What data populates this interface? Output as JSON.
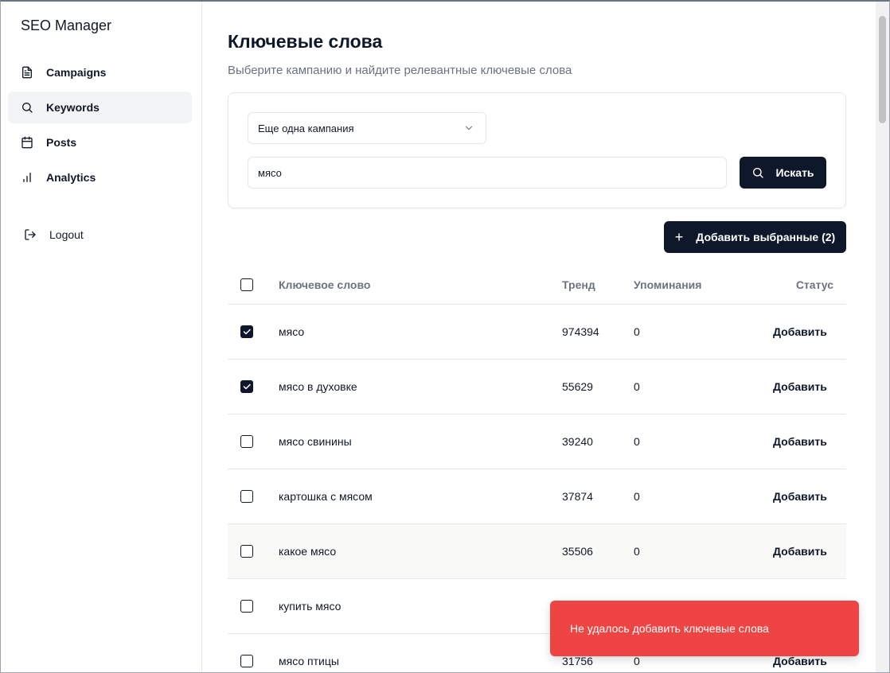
{
  "app": {
    "brand": "SEO Manager"
  },
  "sidebar": {
    "items": [
      {
        "label": "Campaigns",
        "icon": "file-text-icon"
      },
      {
        "label": "Keywords",
        "icon": "search-icon",
        "active": true
      },
      {
        "label": "Posts",
        "icon": "calendar-icon"
      },
      {
        "label": "Analytics",
        "icon": "bar-chart-icon"
      }
    ],
    "logout": {
      "label": "Logout",
      "icon": "log-out-icon"
    }
  },
  "main": {
    "title": "Ключевые слова",
    "subtitle": "Выберите кампанию и найдите релевантные ключевые слова",
    "campaign_select": {
      "value": "Еще одна кампания"
    },
    "query": {
      "value": "мясо"
    },
    "search_label": "Искать",
    "add_selected_label": "Добавить выбранные (2)"
  },
  "table": {
    "headers": {
      "keyword": "Ключевое слово",
      "trend": "Тренд",
      "mentions": "Упоминания",
      "status": "Статус"
    },
    "rows": [
      {
        "keyword": "мясо",
        "trend": "974394",
        "mentions": "0",
        "action": "Добавить",
        "checked": true
      },
      {
        "keyword": "мясо в духовке",
        "trend": "55629",
        "mentions": "0",
        "action": "Добавить",
        "checked": true
      },
      {
        "keyword": "мясо свинины",
        "trend": "39240",
        "mentions": "0",
        "action": "Добавить",
        "checked": false
      },
      {
        "keyword": "картошка с мясом",
        "trend": "37874",
        "mentions": "0",
        "action": "Добавить",
        "checked": false
      },
      {
        "keyword": "какое мясо",
        "trend": "35506",
        "mentions": "0",
        "action": "Добавить",
        "checked": false
      },
      {
        "keyword": "купить мясо",
        "trend": "",
        "mentions": "",
        "action": "",
        "checked": false
      },
      {
        "keyword": "мясо птицы",
        "trend": "31756",
        "mentions": "0",
        "action": "Добавить",
        "checked": false
      }
    ]
  },
  "toast": {
    "message": "Не удалось добавить ключевые слова",
    "color": "#ef4444"
  },
  "colors": {
    "primary": "#0f172a",
    "error": "#ef4444"
  }
}
